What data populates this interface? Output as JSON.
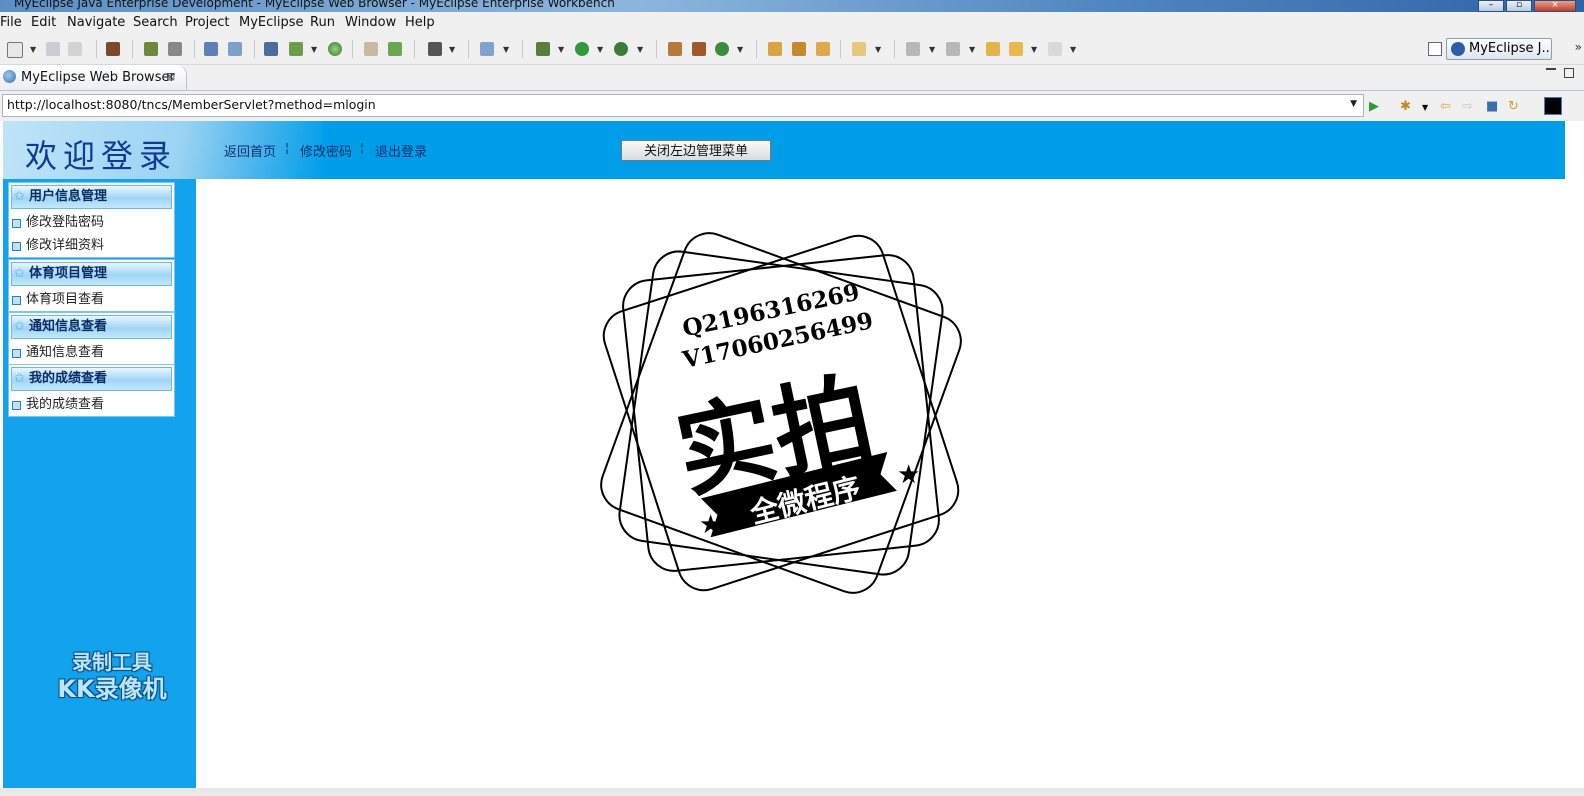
{
  "window": {
    "title": "MyEclipse Java Enterprise Development - MyEclipse Web Browser - MyEclipse Enterprise Workbench"
  },
  "menubar": [
    "File",
    "Edit",
    "Navigate",
    "Search",
    "Project",
    "MyEclipse",
    "Run",
    "Window",
    "Help"
  ],
  "toolbar": {
    "perspective": "MyEclipse J..."
  },
  "tab": {
    "label": "MyEclipse Web Browser",
    "close": "⊠"
  },
  "urlbar": {
    "url": "http://localhost:8080/tncs/MemberServlet?method=mlogin"
  },
  "page": {
    "welcome": "欢迎登录",
    "links": {
      "home": "返回首页",
      "change_pwd": "修改密码",
      "logout": "退出登录",
      "sep": "¦"
    },
    "toggle_menu": "关闭左边管理菜单",
    "menu": [
      {
        "title": "用户信息管理",
        "items": [
          "修改登陆密码",
          "修改详细资料"
        ]
      },
      {
        "title": "体育项目管理",
        "items": [
          "体育项目查看"
        ]
      },
      {
        "title": "通知信息查看",
        "items": [
          "通知信息查看"
        ]
      },
      {
        "title": "我的成绩查看",
        "items": [
          "我的成绩查看"
        ]
      }
    ],
    "watermark": {
      "line1": "录制工具",
      "line2": "KK录像机"
    },
    "stamp": {
      "qq": "Q2196316269",
      "wx": "V17060256499",
      "main": "实拍",
      "banner": "全微程序"
    }
  }
}
